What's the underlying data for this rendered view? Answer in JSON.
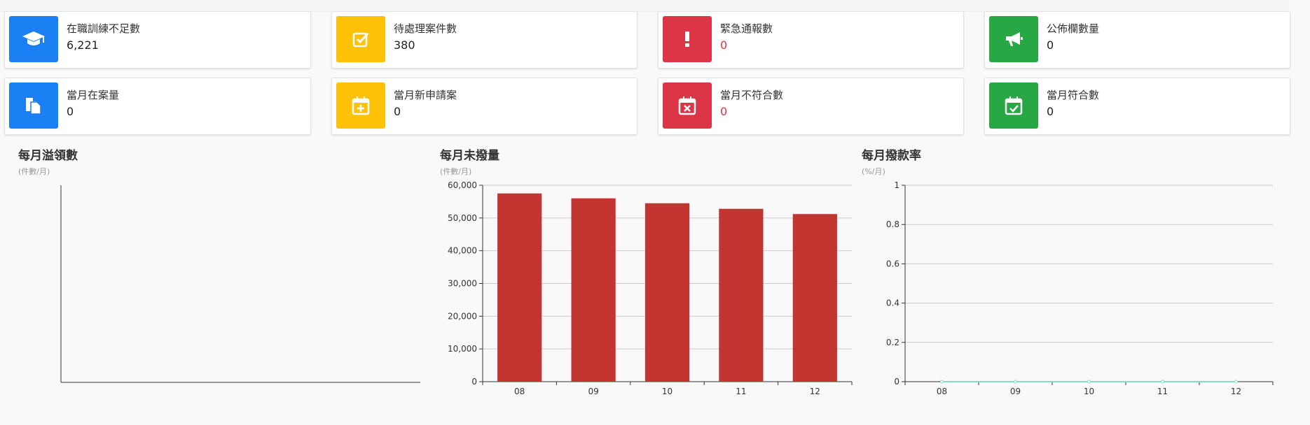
{
  "cards": [
    {
      "label": "在職訓練不足數",
      "value": "6,221",
      "color": "#1a7ff2",
      "icon": "graduation-cap-icon"
    },
    {
      "label": "待處理案件數",
      "value": "380",
      "color": "#fdc107",
      "icon": "check-square-icon"
    },
    {
      "label": "緊急通報數",
      "value": "0",
      "color": "#dc3545",
      "icon": "exclamation-icon",
      "value_color": "#dc3545"
    },
    {
      "label": "公佈欄數量",
      "value": "0",
      "color": "#28a745",
      "icon": "megaphone-icon"
    },
    {
      "label": "當月在案量",
      "value": "0",
      "color": "#1a7ff2",
      "icon": "documents-icon"
    },
    {
      "label": "當月新申請案",
      "value": "0",
      "color": "#fdc107",
      "icon": "calendar-plus-icon"
    },
    {
      "label": "當月不符合數",
      "value": "0",
      "color": "#dc3545",
      "icon": "calendar-x-icon",
      "value_color": "#dc3545"
    },
    {
      "label": "當月符合數",
      "value": "0",
      "color": "#28a745",
      "icon": "calendar-check-icon"
    }
  ],
  "charts": {
    "overflow": {
      "title": "每月溢領數",
      "unit": "(件數/月)"
    },
    "unpaid": {
      "title": "每月未撥量",
      "unit": "(件數/月)"
    },
    "payrate": {
      "title": "每月撥款率",
      "unit": "(%/月)"
    }
  },
  "chart_data": [
    {
      "type": "bar",
      "title": "每月溢領數",
      "ylabel": "(件數/月)",
      "categories": [],
      "values": []
    },
    {
      "type": "bar",
      "title": "每月未撥量",
      "ylabel": "(件數/月)",
      "categories": [
        "08",
        "09",
        "10",
        "11",
        "12"
      ],
      "values": [
        57500,
        56000,
        54500,
        52800,
        51200
      ],
      "ylim": [
        0,
        60000
      ],
      "yticks": [
        "0",
        "10,000",
        "20,000",
        "30,000",
        "40,000",
        "50,000",
        "60,000"
      ],
      "color": "#c23531",
      "grid": true
    },
    {
      "type": "line",
      "title": "每月撥款率",
      "ylabel": "(%/月)",
      "categories": [
        "08",
        "09",
        "10",
        "11",
        "12"
      ],
      "values": [
        0,
        0,
        0,
        0,
        0
      ],
      "ylim": [
        0,
        1
      ],
      "yticks": [
        "0",
        "0.2",
        "0.4",
        "0.6",
        "0.8",
        "1"
      ],
      "color": "#7fe0c8",
      "grid": true
    }
  ]
}
